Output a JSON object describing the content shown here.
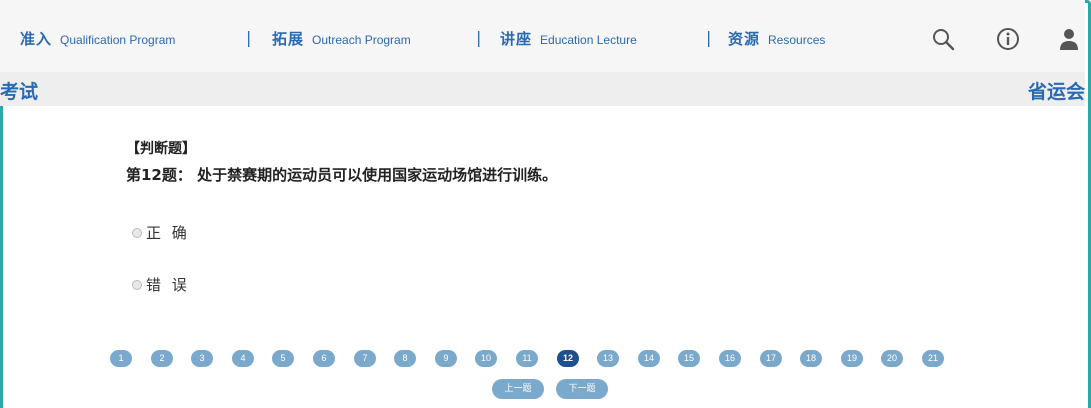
{
  "nav": {
    "items": [
      {
        "cn": "准入",
        "en": "Qualification Program"
      },
      {
        "cn": "拓展",
        "en": "Outreach Program"
      },
      {
        "cn": "讲座",
        "en": "Education Lecture"
      },
      {
        "cn": "资源",
        "en": "Resources"
      }
    ],
    "separator": "|",
    "icons": [
      "search-icon",
      "info-icon",
      "user-icon"
    ]
  },
  "subheader": {
    "left": "考试",
    "right": "省运会"
  },
  "question": {
    "type": "【判断题】",
    "text": "第12题： 处于禁赛期的运动员可以使用国家运动场馆进行训练。",
    "options": [
      "正 确",
      "错 误"
    ]
  },
  "pagination": {
    "pages": [
      "1",
      "2",
      "3",
      "4",
      "5",
      "6",
      "7",
      "8",
      "9",
      "10",
      "11",
      "12",
      "13",
      "14",
      "15",
      "16",
      "17",
      "18",
      "19",
      "20",
      "21"
    ],
    "current": "12",
    "prev_label": "上一题",
    "next_label": "下一题"
  },
  "colors": {
    "accent": "#2a6ab3",
    "frame": "#2aa9a4",
    "page_button": "#7ba9cc",
    "page_active": "#1e4f8f"
  }
}
